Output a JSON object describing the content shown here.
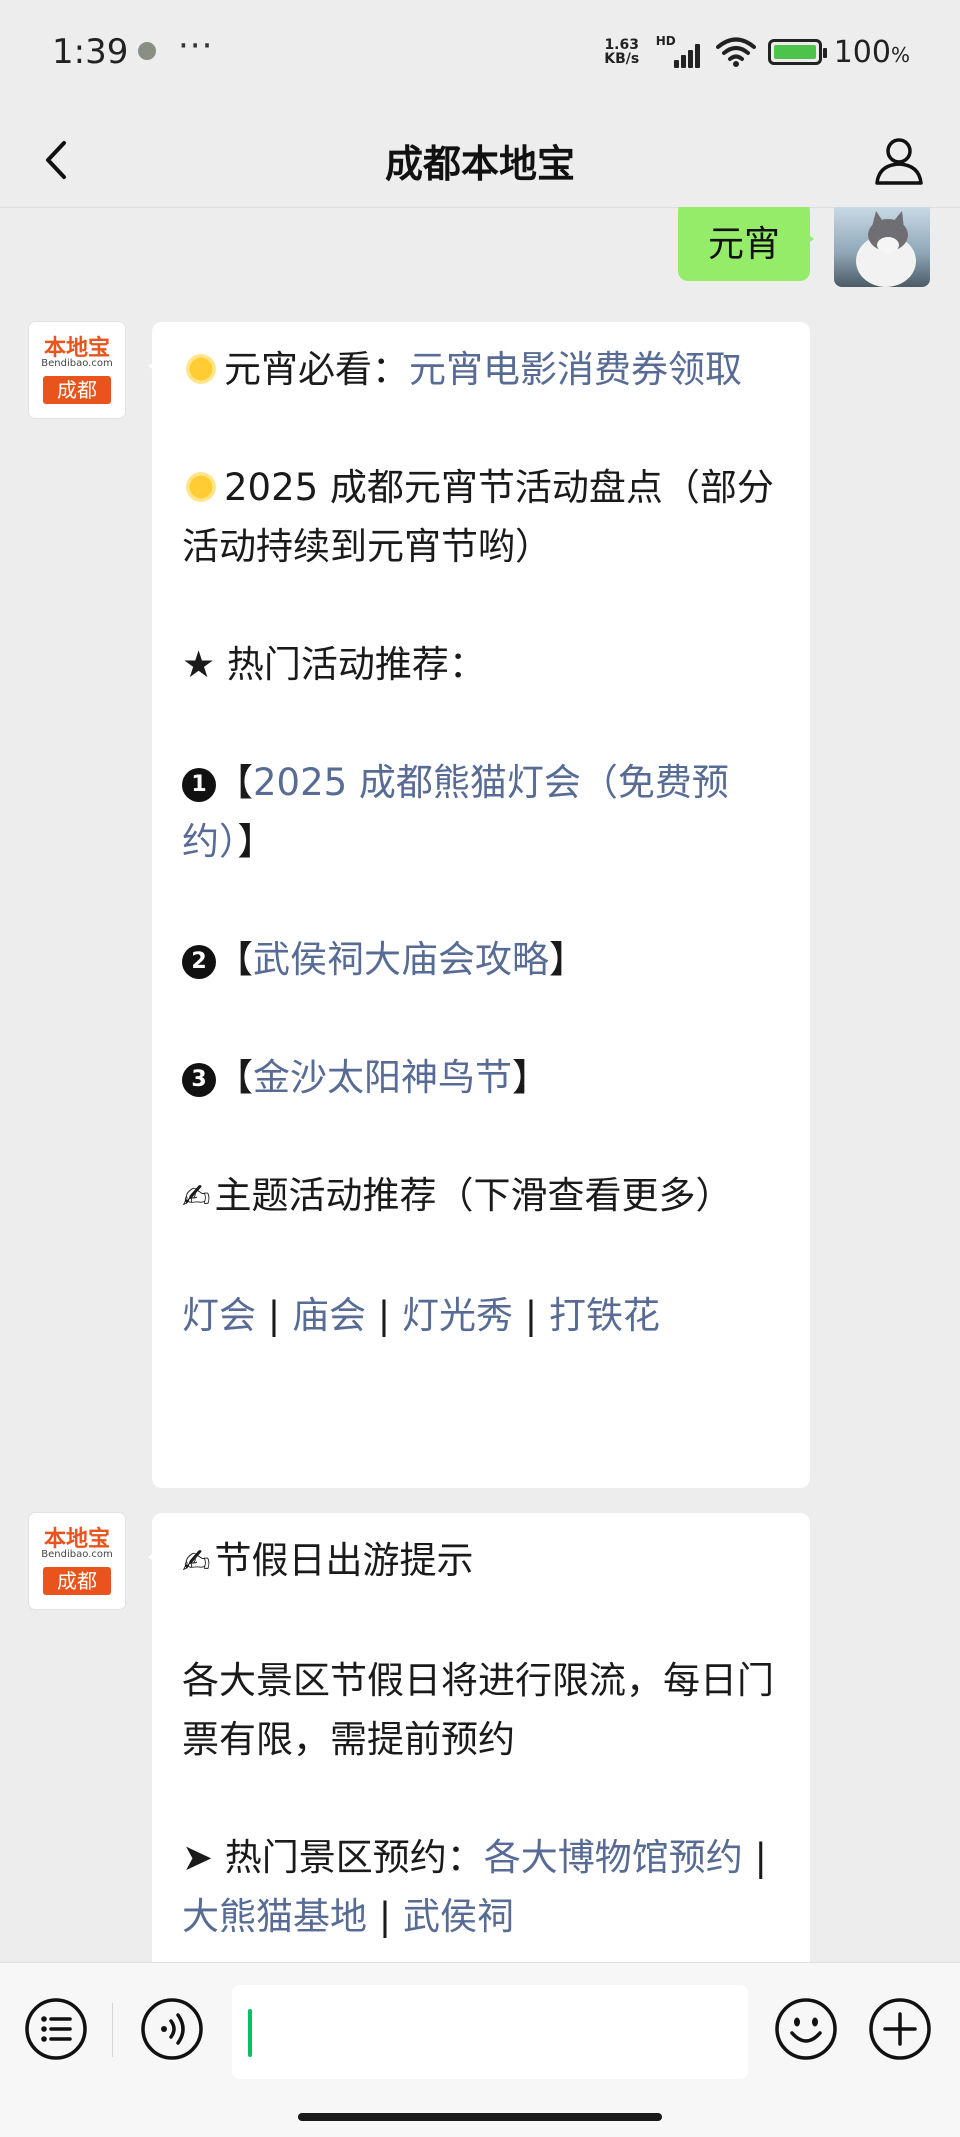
{
  "status_bar": {
    "time": "1:39",
    "dots": "···",
    "net_speed_value": "1.63",
    "net_speed_unit": "KB/s",
    "hd_label": "HD",
    "battery_percent": "100",
    "battery_unit": "%"
  },
  "nav": {
    "title": "成都本地宝"
  },
  "chat": {
    "user_message": "元宵",
    "bot_logo": {
      "top": "本地宝",
      "mid": "Bendibao.com",
      "bottom": "成都"
    },
    "message1": {
      "p1_prefix": "元宵必看：",
      "p1_link": "元宵电影消费券领取",
      "p2": "2025 成都元宵节活动盘点（部分活动持续到元宵节哟）",
      "p3": "★ 热门活动推荐：",
      "items": [
        {
          "num": "1",
          "open": "【",
          "link": "2025 成都熊猫灯会（免费预约）",
          "close": "】"
        },
        {
          "num": "2",
          "open": "【",
          "link": "武侯祠大庙会攻略",
          "close": "】"
        },
        {
          "num": "3",
          "open": "【",
          "link": "金沙太阳神鸟节",
          "close": "】"
        }
      ],
      "p_theme": "主题活动推荐（下滑查看更多）",
      "tags": [
        "灯会",
        "庙会",
        "灯光秀",
        "打铁花"
      ],
      "sep": " | "
    },
    "message2": {
      "p1": "节假日出游提示",
      "p2": "各大景区节假日将进行限流，每日门票有限，需提前预约",
      "p3_prefix": "➤ 热门景区预约：",
      "links": [
        "各大博物馆预约",
        "大熊猫基地",
        "武侯祠"
      ],
      "sep": " | "
    }
  },
  "input_bar": {
    "value": ""
  },
  "colors": {
    "link": "#576b95",
    "user_bubble": "#95ec69",
    "caret": "#07c160",
    "background": "#ededed"
  },
  "icons": [
    "back-icon",
    "profile-icon",
    "menu-list-icon",
    "voice-icon",
    "emoji-icon",
    "plus-icon"
  ]
}
